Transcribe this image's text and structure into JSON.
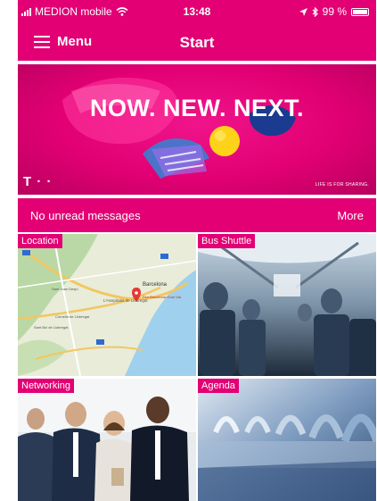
{
  "status_bar": {
    "carrier": "MEDION mobile",
    "time": "13:48",
    "battery": "99 %",
    "icons": [
      "signal-icon",
      "wifi-icon",
      "location-arrow-icon",
      "bluetooth-icon",
      "battery-icon"
    ]
  },
  "nav": {
    "menu_label": "Menu",
    "title": "Start"
  },
  "banner": {
    "headline": "NOW. NEW. NEXT.",
    "logo": "T · ·",
    "claim": "LIFE IS FOR SHARING."
  },
  "messages": {
    "status": "No unread messages",
    "more_label": "More"
  },
  "tiles": [
    {
      "label": "Location",
      "image": "map"
    },
    {
      "label": "Bus Shuttle",
      "image": "bus-interior"
    },
    {
      "label": "Networking",
      "image": "people"
    },
    {
      "label": "Agenda",
      "image": "binder-rings"
    }
  ],
  "map": {
    "city_label": "Barcelona",
    "district_label": "L'Hospitalet de Llobregat",
    "place_label": "Fira Barcelona Gran Via",
    "town_label": "Sant Joan Despí",
    "town2_label": "Cornellà de Llobregat",
    "town3_label": "Sant Boi de Llobregat"
  },
  "colors": {
    "brand": "#e20074",
    "background": "#ffffff"
  }
}
